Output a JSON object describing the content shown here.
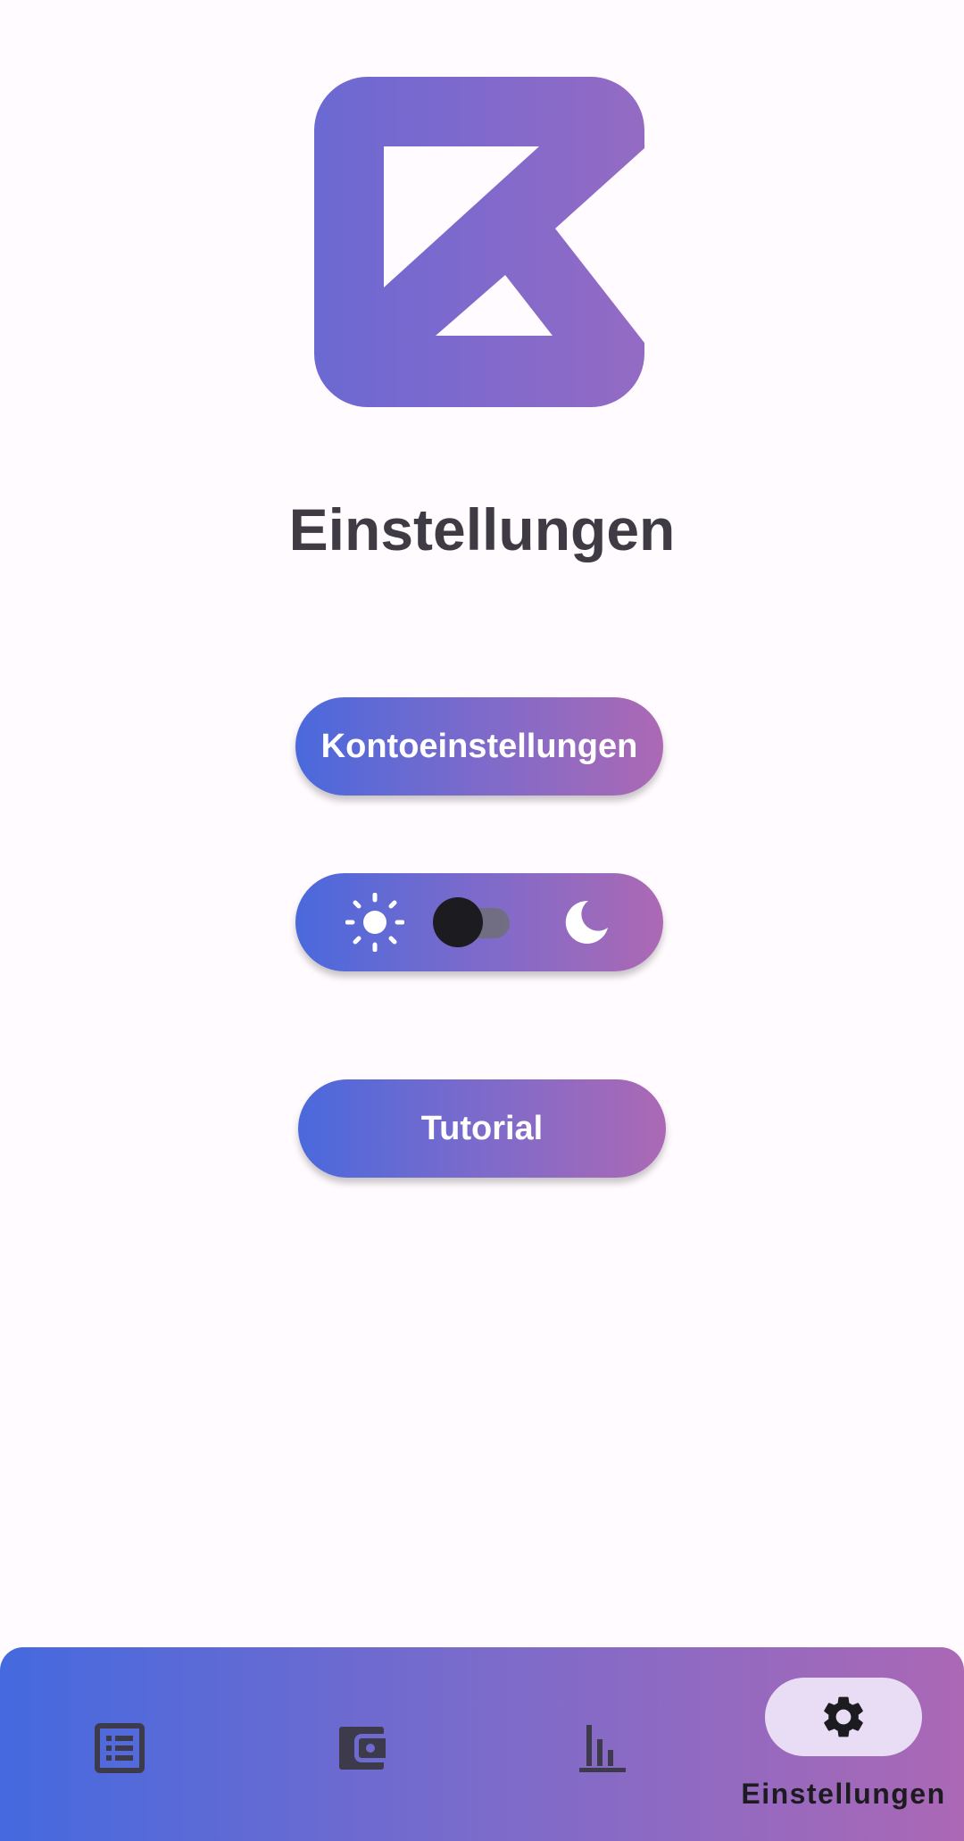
{
  "colors": {
    "background": "#fffbfe",
    "gradient_start": "#4a69dc",
    "gradient_mid": "#7d6acb",
    "gradient_end": "#ac69b4",
    "title_text": "#3f3b44",
    "nav_indicator": "#e9ddf5"
  },
  "header": {
    "logo_icon": "app-logo-icon",
    "title": "Einstellungen"
  },
  "settings": {
    "account_button_label": "Kontoeinstellungen",
    "theme_toggle": {
      "light_icon": "sun-icon",
      "dark_icon": "moon-icon",
      "dark_mode_enabled": false
    },
    "tutorial_button_label": "Tutorial"
  },
  "bottom_nav": {
    "items": [
      {
        "icon": "list-icon",
        "label": "",
        "active": false
      },
      {
        "icon": "wallet-icon",
        "label": "",
        "active": false
      },
      {
        "icon": "bar-chart-icon",
        "label": "",
        "active": false
      },
      {
        "icon": "gear-icon",
        "label": "Einstellungen",
        "active": true
      }
    ]
  }
}
